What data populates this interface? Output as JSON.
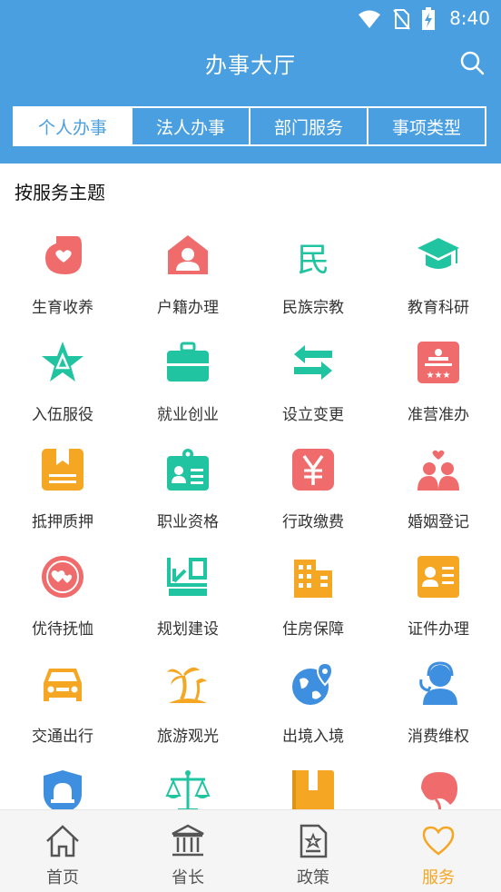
{
  "status": {
    "time": "8:40"
  },
  "header": {
    "title": "办事大厅"
  },
  "tabs": [
    {
      "label": "个人办事",
      "active": true
    },
    {
      "label": "法人办事"
    },
    {
      "label": "部门服务"
    },
    {
      "label": "事项类型"
    }
  ],
  "section": {
    "title": "按服务主题"
  },
  "services": [
    {
      "label": "生育收养",
      "icon": "pregnancy-icon",
      "color": "#f06b6b"
    },
    {
      "label": "户籍办理",
      "icon": "household-icon",
      "color": "#f06b6b"
    },
    {
      "label": "民族宗教",
      "icon": "ethnic-religion-icon",
      "color": "#20c4a0"
    },
    {
      "label": "教育科研",
      "icon": "graduation-cap-icon",
      "color": "#20c4a0"
    },
    {
      "label": "入伍服役",
      "icon": "military-star-icon",
      "color": "#20c4a0"
    },
    {
      "label": "就业创业",
      "icon": "briefcase-icon",
      "color": "#20c4a0"
    },
    {
      "label": "设立变更",
      "icon": "swap-arrows-icon",
      "color": "#20c4a0"
    },
    {
      "label": "准营准办",
      "icon": "license-icon",
      "color": "#f06b6b"
    },
    {
      "label": "抵押质押",
      "icon": "bookmark-book-icon",
      "color": "#f5a623"
    },
    {
      "label": "职业资格",
      "icon": "id-badge-icon",
      "color": "#20c4a0"
    },
    {
      "label": "行政缴费",
      "icon": "yuan-icon",
      "color": "#f06b6b"
    },
    {
      "label": "婚姻登记",
      "icon": "couple-icon",
      "color": "#f06b6b"
    },
    {
      "label": "优待抚恤",
      "icon": "care-heart-icon",
      "color": "#f06b6b"
    },
    {
      "label": "规划建设",
      "icon": "planning-icon",
      "color": "#20c4a0"
    },
    {
      "label": "住房保障",
      "icon": "building-icon",
      "color": "#f5a623"
    },
    {
      "label": "证件办理",
      "icon": "id-card-icon",
      "color": "#f5a623"
    },
    {
      "label": "交通出行",
      "icon": "car-icon",
      "color": "#f5a623"
    },
    {
      "label": "旅游观光",
      "icon": "palm-tree-icon",
      "color": "#f5a623"
    },
    {
      "label": "出境入境",
      "icon": "globe-pin-icon",
      "color": "#3f8fe0"
    },
    {
      "label": "消费维权",
      "icon": "customer-service-icon",
      "color": "#3f8fe0"
    },
    {
      "label": "",
      "icon": "police-siren-icon",
      "color": "#3f8fe0"
    },
    {
      "label": "",
      "icon": "scales-icon",
      "color": "#20c4a0"
    },
    {
      "label": "",
      "icon": "archive-book-icon",
      "color": "#f5a623"
    },
    {
      "label": "",
      "icon": "leaf-icon",
      "color": "#f06b6b"
    }
  ],
  "bottom_nav": [
    {
      "label": "首页",
      "icon": "home-icon"
    },
    {
      "label": "省长",
      "icon": "government-building-icon"
    },
    {
      "label": "政策",
      "icon": "policy-document-icon"
    },
    {
      "label": "服务",
      "icon": "heart-icon",
      "active": true
    }
  ]
}
